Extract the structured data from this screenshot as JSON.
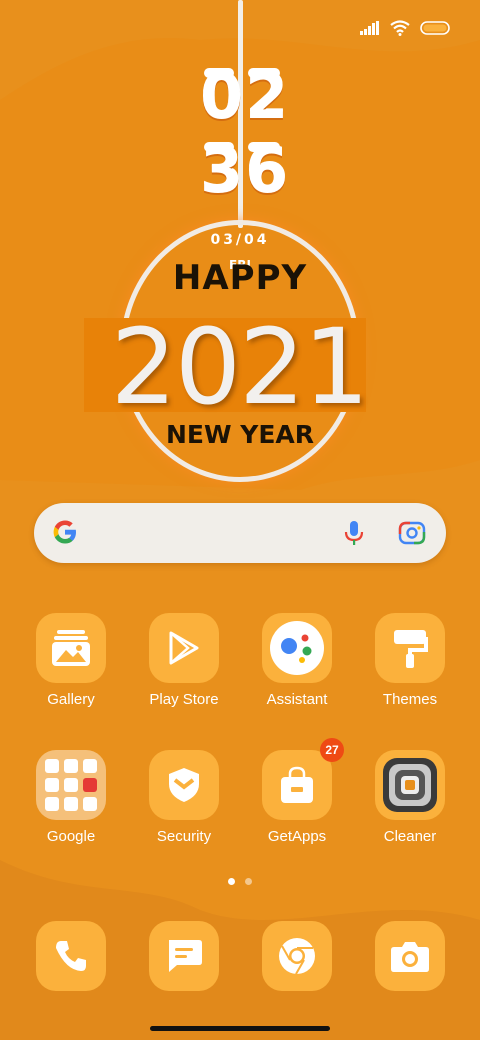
{
  "clock": {
    "hours": "02",
    "minutes": "36",
    "date": "03/04",
    "day": "FRI"
  },
  "greeting": {
    "line1": "HAPPY",
    "year": "2021",
    "line2": "NEW YEAR"
  },
  "apps_row1": [
    {
      "label": "Gallery",
      "icon": "gallery-icon"
    },
    {
      "label": "Play Store",
      "icon": "play-store-icon"
    },
    {
      "label": "Assistant",
      "icon": "assistant-icon"
    },
    {
      "label": "Themes",
      "icon": "themes-icon"
    }
  ],
  "apps_row2": [
    {
      "label": "Google",
      "icon": "google-folder-icon"
    },
    {
      "label": "Security",
      "icon": "security-icon"
    },
    {
      "label": "GetApps",
      "icon": "getapps-icon",
      "badge": "27"
    },
    {
      "label": "Cleaner",
      "icon": "cleaner-icon"
    }
  ],
  "dock": [
    {
      "icon": "phone-icon"
    },
    {
      "icon": "messages-icon"
    },
    {
      "icon": "chrome-icon"
    },
    {
      "icon": "camera-icon"
    }
  ],
  "pages": {
    "count": 2,
    "current": 1
  },
  "colors": {
    "background": "#e8901c",
    "icon_bg": "#fbb13c",
    "badge": "#ef4a14"
  }
}
